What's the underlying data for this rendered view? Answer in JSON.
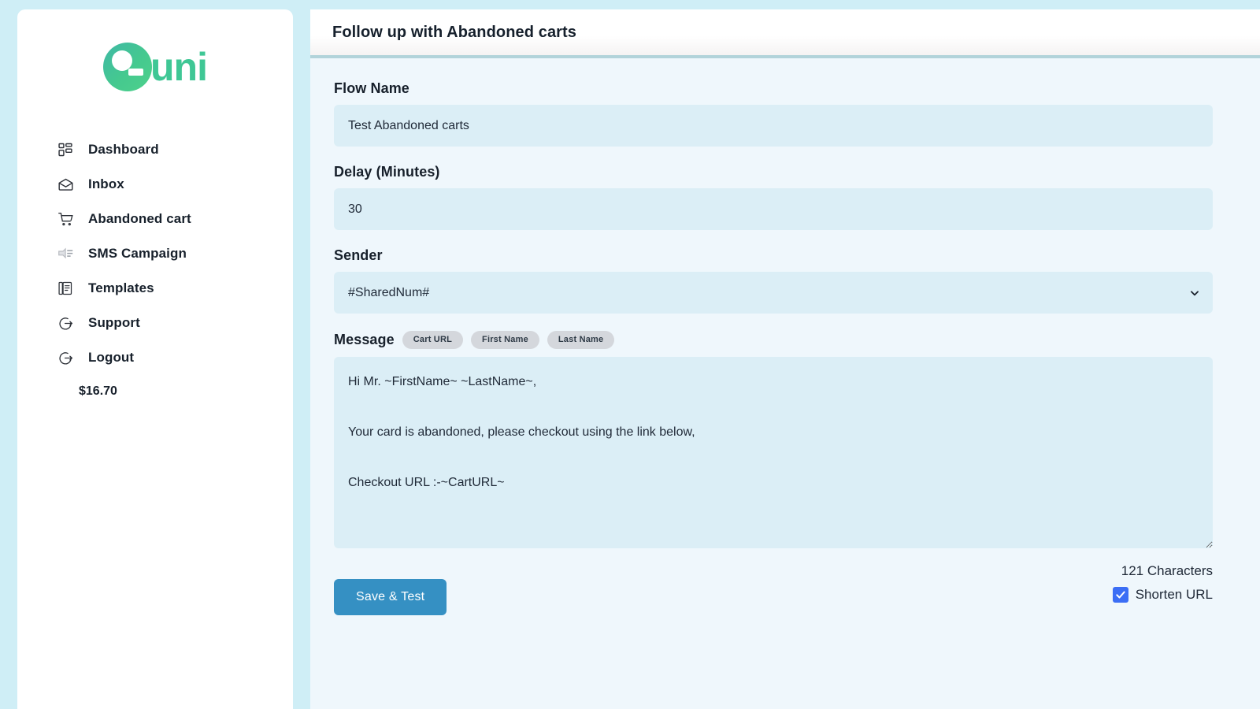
{
  "theme": {
    "page_background": "#cfeef6",
    "sidebar_background": "#ffffff",
    "panel_background": "#eff7fc",
    "input_background": "#dbeef6",
    "accent_button": "#3590c3",
    "checkbox_blue": "#3b6ef5",
    "logo_green": "#3fc795",
    "pill_gray": "#d4d7dc"
  },
  "sidebar": {
    "logo": {
      "mark": "G",
      "text": "uni",
      "full": "Guni"
    },
    "items": [
      {
        "label": "Dashboard",
        "icon": "dashboard-grid-icon"
      },
      {
        "label": "Inbox",
        "icon": "inbox-tray-icon"
      },
      {
        "label": "Abandoned cart",
        "icon": "shopping-cart-icon"
      },
      {
        "label": "SMS Campaign",
        "icon": "sms-campaign-icon"
      },
      {
        "label": "Templates",
        "icon": "templates-documents-icon"
      },
      {
        "label": "Support",
        "icon": "support-arrow-icon"
      },
      {
        "label": "Logout",
        "icon": "logout-arrow-icon"
      }
    ],
    "balance": "$16.70"
  },
  "header": {
    "title": "Follow up with Abandoned carts"
  },
  "form": {
    "flow_name": {
      "label": "Flow Name",
      "value": "Test Abandoned carts",
      "placeholder": "Flow Name"
    },
    "delay": {
      "label": "Delay (Minutes)",
      "value": "30",
      "placeholder": "Delay (Minutes)"
    },
    "sender": {
      "label": "Sender",
      "value": "#SharedNum#",
      "options": [
        "#SharedNum#"
      ]
    },
    "message": {
      "label": "Message",
      "tokens": [
        {
          "label": "Cart URL"
        },
        {
          "label": "First Name"
        },
        {
          "label": "Last Name"
        }
      ],
      "value": "Hi Mr. ~FirstName~ ~LastName~,\n\nYour card is abandoned, please checkout using the link below,\n\nCheckout URL :-~CartURL~",
      "placeholder": "Message"
    },
    "character_count": "121 Characters",
    "shorten_url": {
      "label": "Shorten URL",
      "checked": true
    },
    "save_button": "Save & Test"
  }
}
